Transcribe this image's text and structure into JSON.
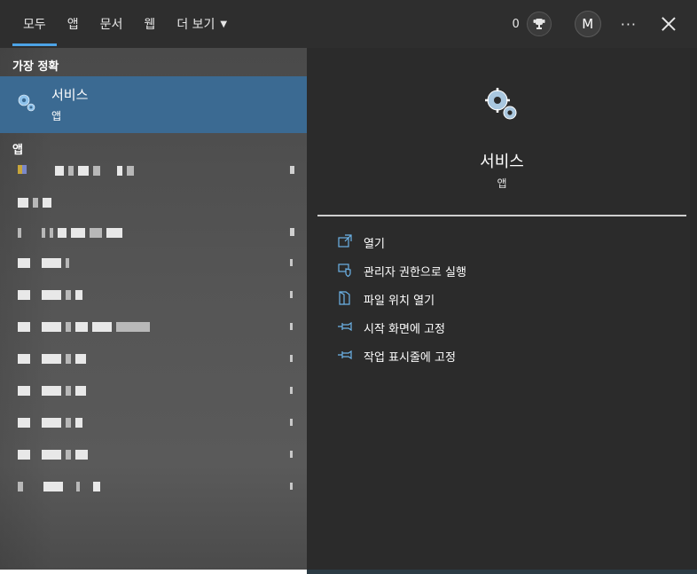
{
  "tabs": [
    {
      "label": "모두",
      "active": true
    },
    {
      "label": "앱"
    },
    {
      "label": "문서"
    },
    {
      "label": "웹"
    },
    {
      "label": "더 보기"
    }
  ],
  "header": {
    "points": "0",
    "avatar_initial": "M",
    "more": "···"
  },
  "best_match": {
    "section_label": "가장 정확",
    "title": "서비스",
    "subtitle": "앱"
  },
  "apps_section_label": "앱",
  "preview": {
    "title": "서비스",
    "subtitle": "앱",
    "actions": [
      {
        "label": "열기",
        "icon": "open-icon"
      },
      {
        "label": "관리자 권한으로 실행",
        "icon": "admin-shield-icon"
      },
      {
        "label": "파일 위치 열기",
        "icon": "file-location-icon"
      },
      {
        "label": "시작 화면에 고정",
        "icon": "pin-icon"
      },
      {
        "label": "작업 표시줄에 고정",
        "icon": "pin-icon"
      }
    ]
  },
  "colors": {
    "accent": "#4ca3e6",
    "selected": "#3b6a92",
    "icon": "#6cb3e8"
  }
}
